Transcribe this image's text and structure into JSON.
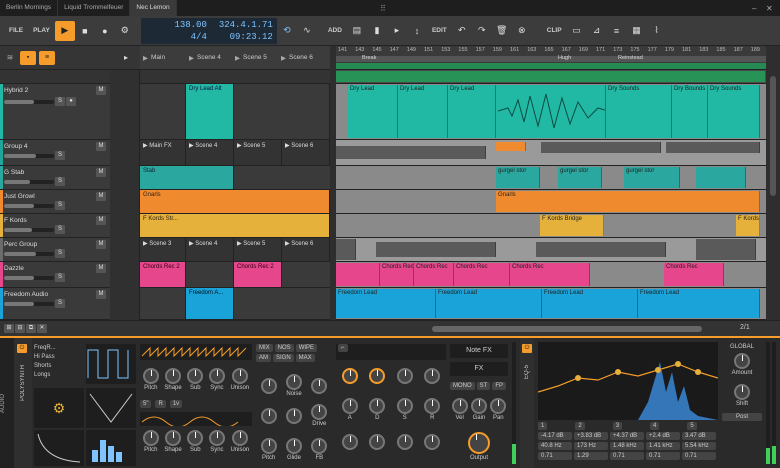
{
  "tabs": [
    "Berlin Mornings",
    "Liquid Trommelfeuer",
    "Nec Lemon"
  ],
  "transport": {
    "file": "FILE",
    "play_label": "PLAY",
    "tempo": "138.00",
    "time_sig": "4/4",
    "position": "324.4.1.71",
    "time": "09:23.12",
    "add": "ADD",
    "edit": "EDIT",
    "clip": "CLIP"
  },
  "tracks": [
    {
      "name": "Hybrid 2",
      "color": "#21b9a3"
    },
    {
      "name": "Group 4",
      "color": "#1fa59a"
    },
    {
      "name": "G Stab",
      "color": "#2aa89f"
    },
    {
      "name": "Just Growl",
      "color": "#f08a2e"
    },
    {
      "name": "F Kords",
      "color": "#e6b13a"
    },
    {
      "name": "Perc Group",
      "color": "#6b6b6b"
    },
    {
      "name": "Dazzle",
      "color": "#e5468c"
    },
    {
      "name": "Freedom Audio",
      "color": "#1aa3d8"
    }
  ],
  "scenes": [
    "Main",
    "Scene 4",
    "Scene 5",
    "Scene 6"
  ],
  "clips": {
    "hybrid": "Dry Lead Alt",
    "group_main": "Main FX",
    "gstab": "Stab",
    "growl": "Gnarls",
    "kords": "F Kords Str...",
    "perc_scene3": "Scene 3",
    "dazzle_1": "Chords Rec 2",
    "dazzle_2": "Chords Rec 2",
    "freedom": "Freedom A..."
  },
  "ruler": {
    "bars": [
      "141",
      "143",
      "145",
      "147",
      "149",
      "151",
      "153",
      "155",
      "157",
      "159",
      "161",
      "163",
      "165",
      "167",
      "169",
      "171",
      "173",
      "175",
      "177",
      "179",
      "181",
      "183",
      "185",
      "187",
      "189"
    ],
    "markers": [
      "Break",
      "Hugh",
      "Reinstead"
    ]
  },
  "arranger": {
    "hybrid_regions": [
      "Dry Lead",
      "Dry Lead",
      "Dry Lead",
      "Dry Sounds",
      "Dry Bounds",
      "Dry Sounds"
    ],
    "gstab_regions": [
      "gurgel stor",
      "gurgel stor",
      "gurgel stor"
    ],
    "growl_regions": [
      "Gnarls"
    ],
    "kords_regions": [
      "F Kords Bridge",
      "F Kords"
    ],
    "dazzle_regions": [
      "Chords Rec",
      "Chords Rec",
      "Chords Rec",
      "Chords Rec",
      "Chords Rec"
    ],
    "freedom_regions": [
      "Freedom Lead",
      "Freedom Lead",
      "Freedom Lead",
      "Freedom Lead"
    ]
  },
  "zoom": "2/1",
  "device": {
    "side_label": "AUDIO",
    "polysynth": "POLYSYNTH",
    "filters": [
      "FreqR...",
      "Hi Pass",
      "Shorts",
      "Longs"
    ],
    "osc_knobs": [
      "Pitch",
      "Shape",
      "Sub",
      "Sync",
      "Unison"
    ],
    "osc_vals": [
      "5\"",
      "R",
      "1v"
    ],
    "mix_tabs": [
      "MIX",
      "NOS",
      "WIPE",
      "AM",
      "SIGN",
      "MAX"
    ],
    "mix_knobs": [
      "Noise",
      "Drive"
    ],
    "bottom_knobs": [
      "Pitch",
      "Glide",
      "FB"
    ],
    "env_knobs": [
      "A",
      "D",
      "S",
      "R"
    ],
    "env_labels": [
      "Note FX",
      "FX"
    ],
    "voice_tabs": [
      "MONO",
      "ST",
      "FP"
    ],
    "voice_knobs": [
      "Vel",
      "Gain",
      "Pan"
    ],
    "output": "Output",
    "eq_label": "EQ-5",
    "global": "GLOBAL",
    "amount": "Amount",
    "shift": "Shift",
    "post": "Post",
    "eq_bands": [
      "1",
      "2",
      "3",
      "4",
      "5"
    ],
    "eq_gains": [
      "-4.17 dB",
      "+3.83 dB",
      "+4.37 dB",
      "+2.4 dB",
      "3.47 dB"
    ],
    "eq_freqs": [
      "40.8 Hz",
      "173 Hz",
      "1.48 kHz",
      "1.41 kHz",
      "5.54 kHz"
    ],
    "eq_q": [
      "0.71",
      "1.29",
      "0.71",
      "0.71",
      "0.71"
    ]
  },
  "colors": {
    "accent": "#f59c2a",
    "teal": "#21b9a3",
    "orange": "#f08a2e",
    "pink": "#e5468c",
    "blue": "#1aa3d8",
    "yellow": "#e6b13a"
  }
}
